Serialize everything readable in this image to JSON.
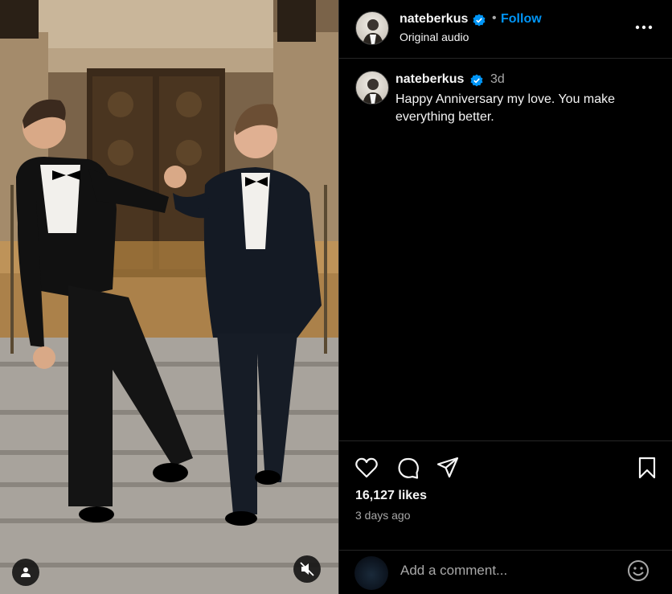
{
  "post": {
    "username": "nateberkus",
    "follow_label": "Follow",
    "separator": "•",
    "audio_label": "Original audio",
    "caption_time": "3d",
    "caption_text": "Happy Anniversary my love. You make everything better.",
    "likes": "16,127 likes",
    "date": "3 days ago",
    "comment_placeholder": "Add a comment..."
  },
  "icons": {
    "more": "more-options-icon",
    "like": "heart-icon",
    "comment": "comment-icon",
    "share": "share-icon",
    "save": "bookmark-icon",
    "emoji": "emoji-icon",
    "tag": "user-tag-icon",
    "mute": "muted-speaker-icon",
    "verified": "verified-badge-icon"
  },
  "colors": {
    "background": "#000000",
    "link_blue": "#0095f6",
    "verified_blue": "#0095f6",
    "muted_text": "#a8a8a8",
    "divider": "#262626"
  }
}
